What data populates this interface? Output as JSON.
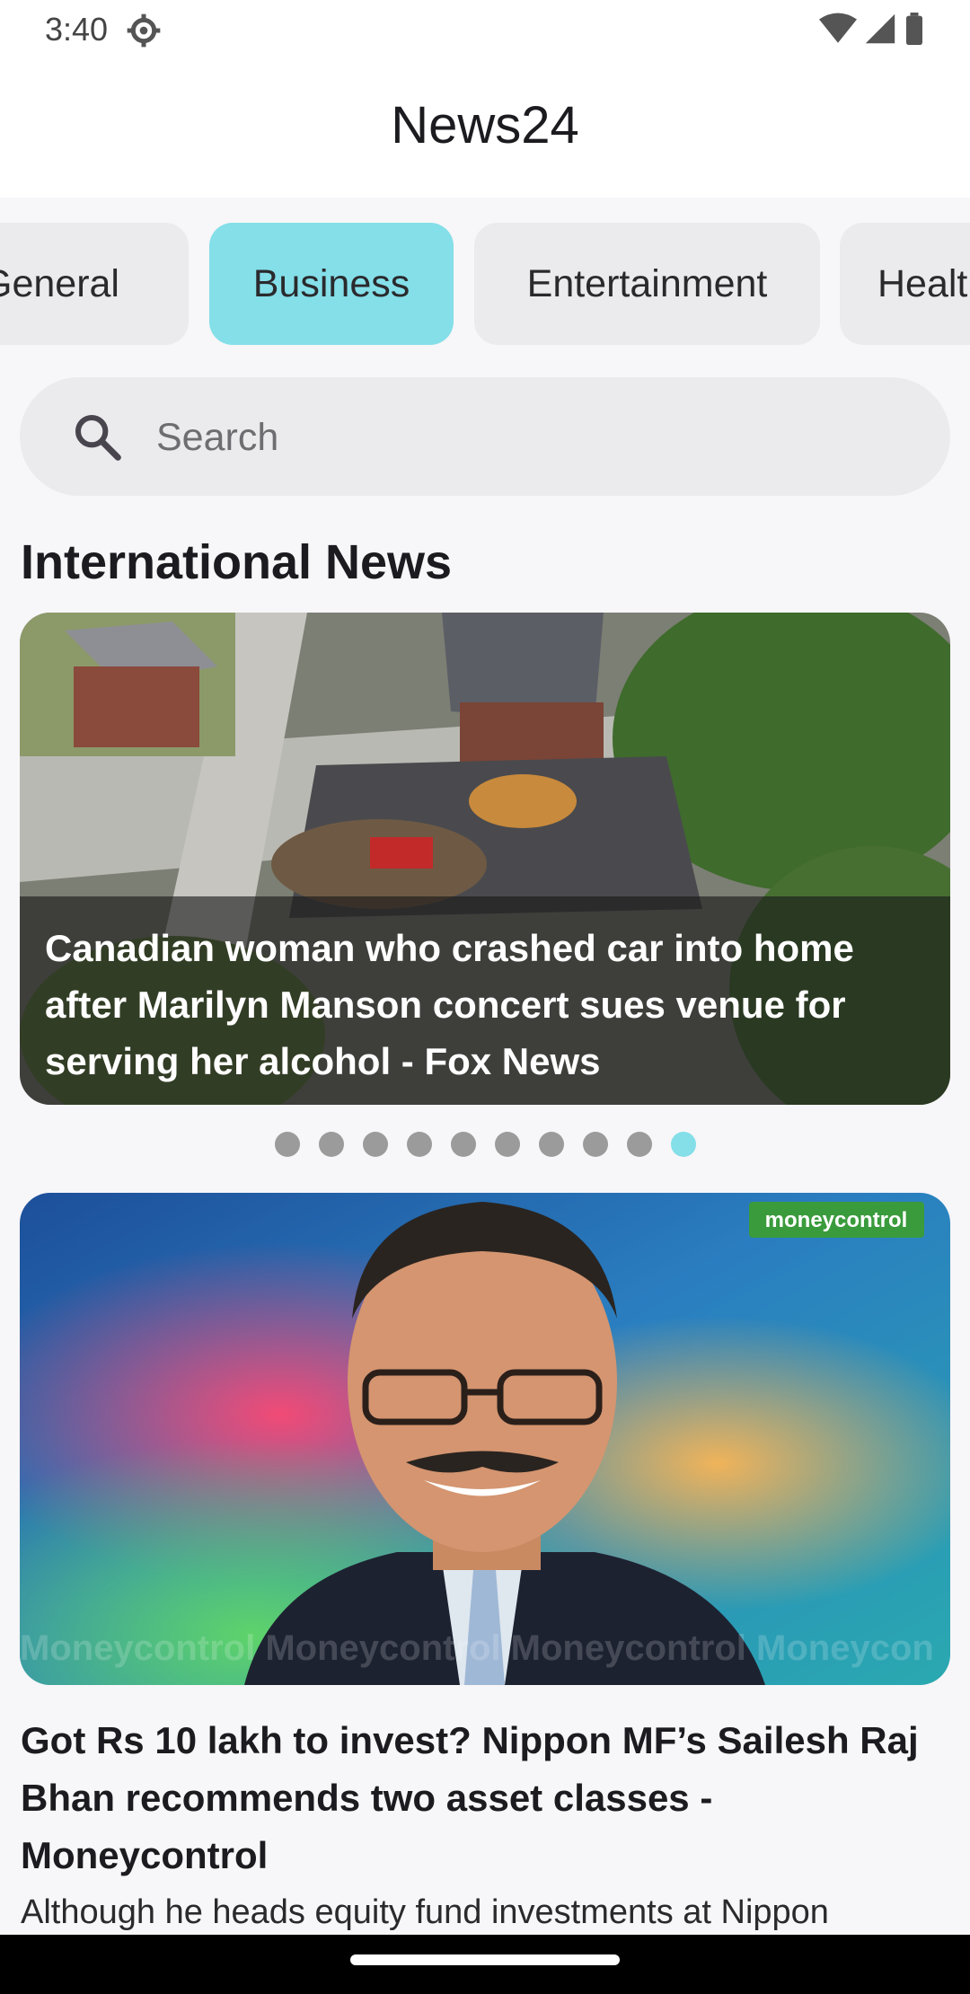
{
  "status_bar": {
    "time": "3:40",
    "icons": [
      "gear-icon",
      "wifi-icon",
      "cellular-icon",
      "battery-icon"
    ]
  },
  "app_bar": {
    "title": "News24"
  },
  "categories": {
    "items": [
      "General",
      "Business",
      "Entertainment",
      "Health"
    ],
    "selected": "Business"
  },
  "search": {
    "placeholder": "Search",
    "value": ""
  },
  "section": {
    "title": "International News"
  },
  "carousel": {
    "caption": "Canadian woman who crashed car into home after Marilyn Manson concert sues venue for serving her alcohol - Fox News",
    "page_count": 10,
    "active_index": 9
  },
  "article": {
    "image_logo": "moneycontrol",
    "image_watermark": "Moneycontrol Moneycontrol Moneycontrol Moneycon",
    "title": "Got Rs 10 lakh to invest? Nippon MF’s Sailesh Raj Bhan recommends two asset classes - Moneycontrol",
    "description": "Although he heads equity fund investments at Nippon"
  },
  "colors": {
    "accent": "#84dfe9",
    "chip": "#ebebed",
    "background": "#f7f6f8"
  }
}
